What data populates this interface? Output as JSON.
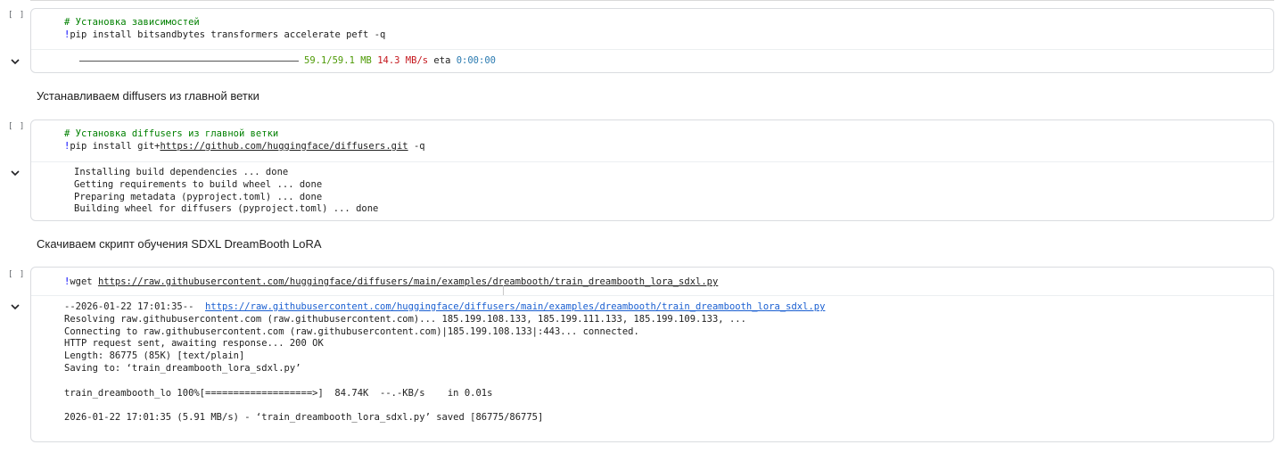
{
  "cells": [
    {
      "exec": "[ ]",
      "code_comment": "# Установка зависимостей",
      "code_line": "pip install bitsandbytes transformers accelerate peft -q",
      "output": {
        "size": "59.1/59.1 MB",
        "speed": "14.3 MB/s",
        "eta_label": "eta",
        "eta": "0:00:00"
      }
    },
    {
      "markdown": "Устанавливаем diffusers из главной ветки",
      "exec": "[ ]",
      "code_comment": "# Установка diffusers из главной ветки",
      "code_prefix": "pip install git+",
      "code_url": "https://github.com/huggingface/diffusers.git",
      "code_suffix": " -q",
      "output_lines": [
        "Installing build dependencies ... done",
        "Getting requirements to build wheel ... done",
        "Preparing metadata (pyproject.toml) ... done",
        "Building wheel for diffusers (pyproject.toml) ... done"
      ]
    },
    {
      "markdown": "Скачиваем скрипт обучения SDXL DreamBooth LoRA",
      "exec": "[ ]",
      "code_prefix": "wget ",
      "code_url": "https://raw.githubusercontent.com/huggingface/diffusers/main/examples/dreambooth/train_dreambooth_lora_sdxl.py",
      "output": {
        "line1_prefix": "--2026-01-22 17:01:35--  ",
        "line1_url": "https://raw.githubusercontent.com/huggingface/diffusers/main/examples/dreambooth/train_dreambooth_lora_sdxl.py",
        "lines": [
          "Resolving raw.githubusercontent.com (raw.githubusercontent.com)... 185.199.108.133, 185.199.111.133, 185.199.109.133, ...",
          "Connecting to raw.githubusercontent.com (raw.githubusercontent.com)|185.199.108.133|:443... connected.",
          "HTTP request sent, awaiting response... 200 OK",
          "Length: 86775 (85K) [text/plain]",
          "Saving to: ‘train_dreambooth_lora_sdxl.py’"
        ],
        "progress": "train_dreambooth_lo 100%[===================>]  84.74K  --.-KB/s    in 0.01s",
        "saved": "2026-01-22 17:01:35 (5.91 MB/s) - ‘train_dreambooth_lora_sdxl.py’ saved [86775/86775]"
      }
    }
  ],
  "icons": {
    "collapse": "chevron-down-icon"
  }
}
